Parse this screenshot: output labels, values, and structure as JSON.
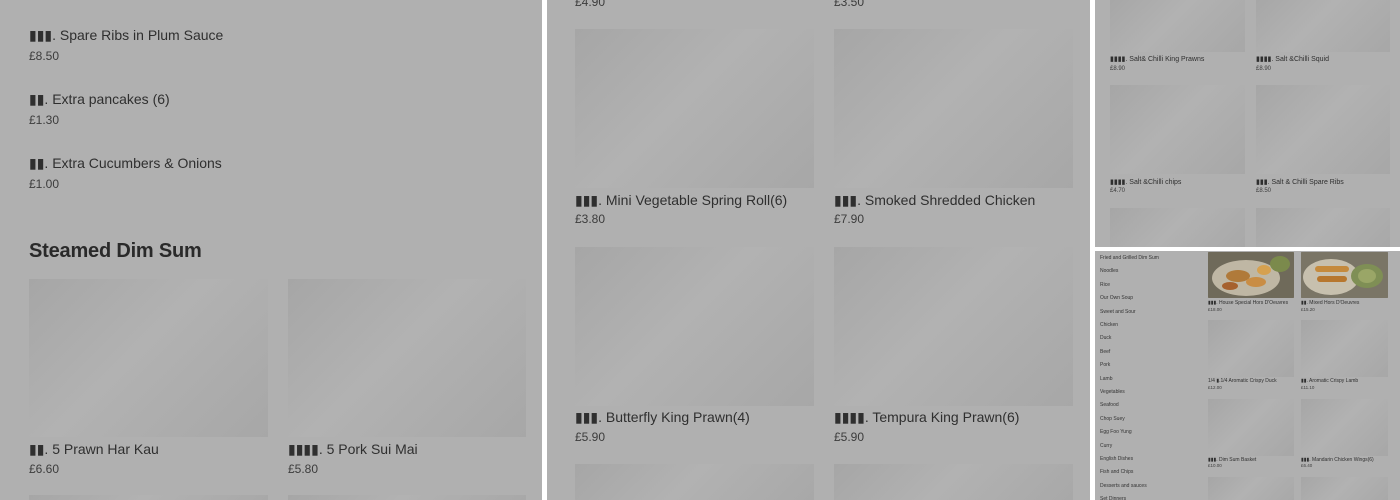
{
  "panel1": {
    "items_top": [
      {
        "name": "▮▮▮. Spare Ribs in Plum Sauce",
        "price": "£8.50"
      },
      {
        "name": "▮▮. Extra pancakes (6)",
        "price": "£1.30"
      },
      {
        "name": "▮▮. Extra Cucumbers & Onions",
        "price": "£1.00"
      }
    ],
    "section_title": "Steamed Dim Sum",
    "grid_items": [
      {
        "name": "▮▮.  5 Prawn Har Kau",
        "price": "£6.60"
      },
      {
        "name": "▮▮▮▮. 5 Pork Sui Mai",
        "price": "£5.80"
      }
    ]
  },
  "panel2": {
    "top_prices": [
      "£4.90",
      "£3.50"
    ],
    "grid_items": [
      {
        "name": "▮▮▮. Mini Vegetable Spring Roll(6)",
        "price": "£3.80"
      },
      {
        "name": "▮▮▮. Smoked Shredded Chicken",
        "price": "£7.90"
      },
      {
        "name": "▮▮▮. Butterfly King Prawn(4)",
        "price": "£5.90"
      },
      {
        "name": "▮▮▮▮. Tempura King Prawn(6)",
        "price": "£5.90"
      }
    ]
  },
  "panel3": {
    "grid_items": [
      {
        "name": "▮▮▮▮. Salt& Chilli King Prawns",
        "price": "£8.90"
      },
      {
        "name": "▮▮▮▮. Salt &Chilli Squid",
        "price": "£8.90"
      },
      {
        "name": "▮▮▮▮. Salt &Chilli chips",
        "price": "£4.70"
      },
      {
        "name": "▮▮▮. Salt & Chilli Spare Ribs",
        "price": "£8.50"
      }
    ]
  },
  "panel4": {
    "categories": [
      "Fried and Grilled Dim Sum",
      "Noodles",
      "Rice",
      "Our Own Soup",
      "Sweet and Sour",
      "Chicken",
      "Duck",
      "Beef",
      "Pork",
      "Lamb",
      "Vegetables",
      "Seafood",
      "Chop Suey",
      "Egg Foo Yung",
      "Curry",
      "English Dishes",
      "Fish and Chips",
      "Desserts and sauces",
      "Set Dinners"
    ],
    "grid_items": [
      {
        "name": "▮▮▮. House Special Hors D'Oeuvres",
        "price": "£18.00"
      },
      {
        "name": "▮▮. Mixed Hors D'Oeuvres",
        "price": "£15.20"
      },
      {
        "name": "1/4 ▮.1/4 Aromatic Crispy Duck",
        "price": "£12.00"
      },
      {
        "name": "▮▮. Aromatic Crispy Lamb",
        "price": "£11.10"
      },
      {
        "name": "▮▮▮.     Dim Sum Basket",
        "price": "£10.00"
      },
      {
        "name": "▮▮▮.     Mandarin Chicken Wings(6)",
        "price": "£6.40"
      }
    ]
  },
  "colors": {
    "overlay": "#b0b0b0",
    "placeholder": "#a8a8a8",
    "text": "#2e2e2e",
    "divider": "#ffffff"
  }
}
